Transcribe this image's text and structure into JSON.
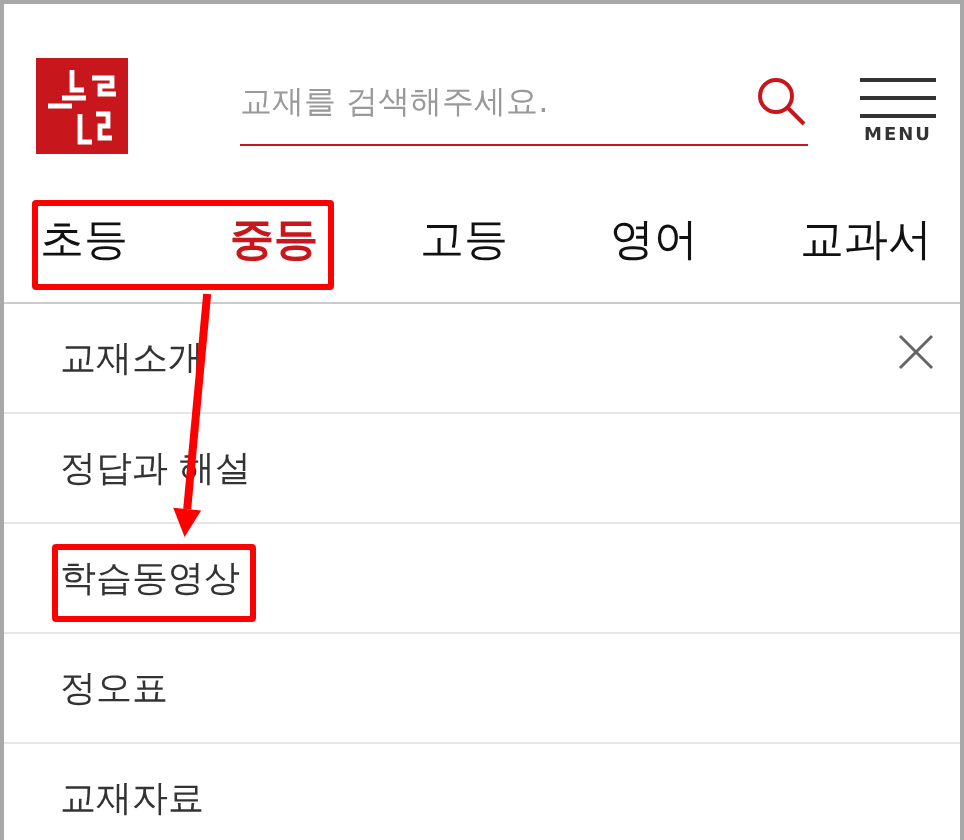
{
  "header": {
    "search": {
      "placeholder": "교재를 검색해주세요."
    },
    "menu_label": "MENU"
  },
  "tabs": [
    {
      "label": "초등",
      "selected": false,
      "highlighted": true
    },
    {
      "label": "중등",
      "selected": true,
      "highlighted": true
    },
    {
      "label": "고등",
      "selected": false,
      "highlighted": false
    },
    {
      "label": "영어",
      "selected": false,
      "highlighted": false
    },
    {
      "label": "교과서",
      "selected": false,
      "highlighted": false
    }
  ],
  "menu_items": [
    {
      "label": "교재소개",
      "highlighted": false
    },
    {
      "label": "정답과 해설",
      "highlighted": false
    },
    {
      "label": "학습동영상",
      "highlighted": true
    },
    {
      "label": "정오표",
      "highlighted": false
    },
    {
      "label": "교재자료",
      "highlighted": false
    }
  ],
  "annotation_arrow": true
}
